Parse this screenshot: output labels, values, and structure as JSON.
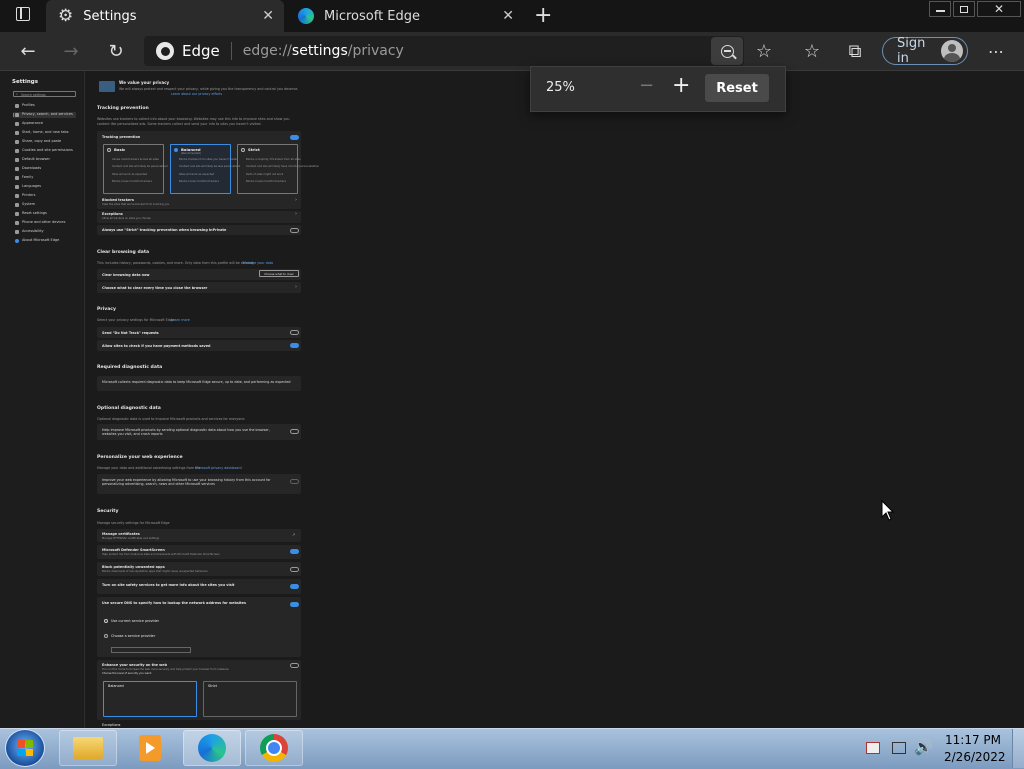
{
  "tabs": [
    {
      "label": "Settings",
      "icon": "gear-icon",
      "active": true
    },
    {
      "label": "Microsoft Edge",
      "icon": "edge-logo-icon",
      "active": false
    }
  ],
  "address": {
    "brand": "Edge",
    "prefix": "edge://",
    "path": "settings",
    "suffix": "/privacy"
  },
  "toolbar": {
    "signin_label": "Sign in"
  },
  "zoom": {
    "level": "25%",
    "minus": "−",
    "plus": "+",
    "reset_label": "Reset"
  },
  "sidebar": {
    "title": "Settings",
    "search_placeholder": "Search settings",
    "items": [
      {
        "label": "Profiles"
      },
      {
        "label": "Privacy, search, and services"
      },
      {
        "label": "Appearance"
      },
      {
        "label": "Start, home, and new tabs"
      },
      {
        "label": "Share, copy and paste"
      },
      {
        "label": "Cookies and site permissions"
      },
      {
        "label": "Default browser"
      },
      {
        "label": "Downloads"
      },
      {
        "label": "Family"
      },
      {
        "label": "Languages"
      },
      {
        "label": "Printers"
      },
      {
        "label": "System"
      },
      {
        "label": "Reset settings"
      },
      {
        "label": "Phone and other devices"
      },
      {
        "label": "Accessibility"
      },
      {
        "label": "About Microsoft Edge"
      }
    ]
  },
  "privacy": {
    "banner_title": "We value your privacy",
    "banner_text": "We will always protect and respect your privacy, while giving you the transparency and control you deserve.",
    "banner_link": "Learn about our privacy efforts",
    "tracking_title": "Tracking prevention",
    "tracking_desc": "Websites use trackers to collect info about your browsing. Websites may use this info to improve sites and show you content like personalized ads. Some trackers collect and send your info to sites you haven't visited.",
    "tracking_row": "Tracking prevention",
    "cards": [
      {
        "name": "Basic",
        "lines": [
          "Allows most trackers across all sites",
          "Content and ads will likely be personalized",
          "Sites will work as expected",
          "Blocks known harmful trackers"
        ]
      },
      {
        "name": "Balanced",
        "badge": "(Recommended)",
        "lines": [
          "Blocks trackers from sites you haven't visited",
          "Content and ads will likely be less personalized",
          "Sites will work as expected",
          "Blocks known harmful trackers"
        ]
      },
      {
        "name": "Strict",
        "lines": [
          "Blocks a majority of trackers from all sites",
          "Content and ads will likely have minimal personalization",
          "Parts of sites might not work",
          "Blocks known harmful trackers"
        ]
      }
    ],
    "blocked_trackers": "Blocked trackers",
    "blocked_desc": "View the sites that we've blocked from tracking you",
    "exceptions": "Exceptions",
    "exceptions_desc": "Allow all trackers on sites you choose",
    "inprivate": "Always use \"Strict\" tracking prevention when browsing InPrivate",
    "clear_title": "Clear browsing data",
    "clear_desc": "This includes history, passwords, cookies, and more. Only data from this profile will be deleted.",
    "clear_link": "Manage your data",
    "clear_now": "Clear browsing data now",
    "clear_button": "Choose what to clear",
    "clear_close": "Choose what to clear every time you close the browser",
    "privacy_title": "Privacy",
    "privacy_desc": "Select your privacy settings for Microsoft Edge.",
    "privacy_link": "Learn more",
    "dnt": "Send \"Do Not Track\" requests",
    "payment": "Allow sites to check if you have payment methods saved",
    "req_title": "Required diagnostic data",
    "req_desc": "Microsoft collects required diagnostic data to keep Microsoft Edge secure, up to date, and performing as expected",
    "opt_title": "Optional diagnostic data",
    "opt_desc": "Optional diagnostic data is used to improve Microsoft products and services for everyone.",
    "opt_row": "Help improve Microsoft products by sending optional diagnostic data about how you use the browser, websites you visit, and crash reports",
    "pers_title": "Personalize your web experience",
    "pers_desc": "Manage your data and additional advertising settings from the",
    "pers_link": "Microsoft privacy dashboard",
    "pers_row": "Improve your web experience by allowing Microsoft to use your browsing history from this account for personalizing advertising, search, news and other Microsoft services",
    "sec_title": "Security",
    "sec_desc": "Manage security settings for Microsoft Edge",
    "certs": "Manage certificates",
    "certs_desc": "Manage HTTPS/SSL certificates and settings",
    "smartscreen": "Microsoft Defender SmartScreen",
    "smartscreen_desc": "Help protect me from malicious sites and downloads with Microsoft Defender SmartScreen",
    "pua": "Block potentially unwanted apps",
    "pua_desc": "Blocks downloads of low-reputation apps that might cause unexpected behaviors",
    "typo": "Turn on site safety services to get more info about the sites you visit",
    "dns": "Use secure DNS to specify how to lookup the network address for websites",
    "dns_opt1": "Use current service provider",
    "dns_opt2": "Choose a service provider",
    "enhance": "Enhance your security on the web",
    "enhance_desc": "Turn on this mode to browse the web more securely and help protect your browser from malware.",
    "enhance_q": "Choose the level of security you want:",
    "balanced_label": "Balanced",
    "strict_label": "Strict",
    "exceptions_bottom": "Exceptions"
  },
  "taskbar": {
    "time": "11:17 PM",
    "date": "2/26/2022"
  },
  "colors": {
    "accent": "#3b8ee6",
    "link": "#5aa0e6"
  }
}
